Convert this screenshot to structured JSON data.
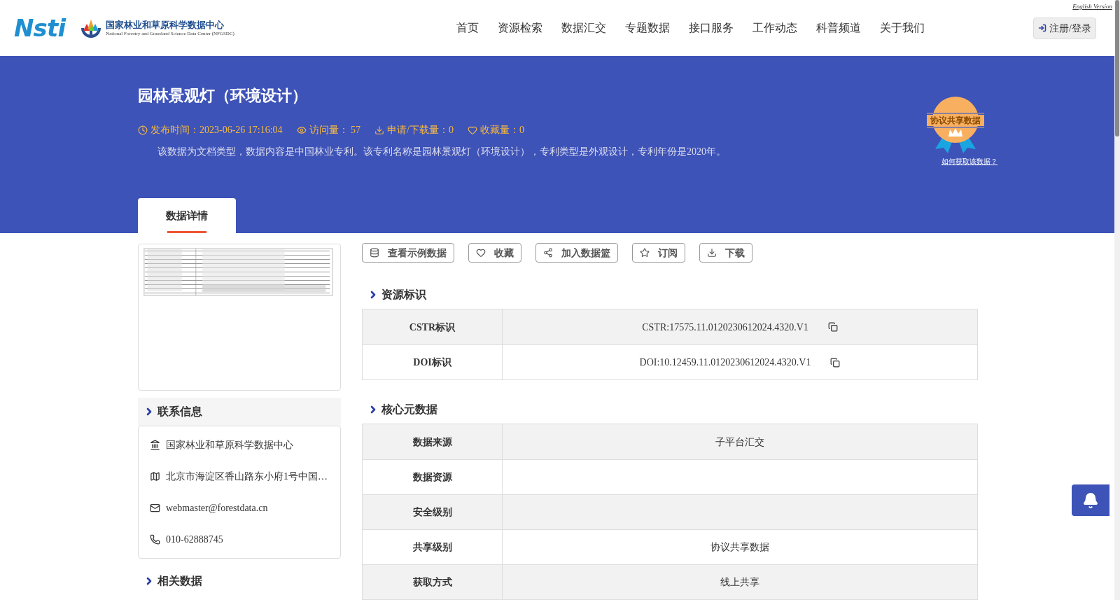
{
  "header": {
    "logo_text": "Nsti",
    "org_name": "国家林业和草原科学数据中心",
    "org_name_en": "National Forestry and Grassland Science Data Center (NFGSDC)",
    "english_link": "English Version",
    "nav": [
      {
        "label": "首页"
      },
      {
        "label": "资源检索"
      },
      {
        "label": "数据汇交"
      },
      {
        "label": "专题数据"
      },
      {
        "label": "接口服务"
      },
      {
        "label": "工作动态"
      },
      {
        "label": "科普频道"
      },
      {
        "label": "关于我们"
      }
    ],
    "login_button": "注册/登录"
  },
  "banner": {
    "title": "园林景观灯（环境设计）",
    "meta": [
      {
        "kind": "time",
        "text": "发布时间：2023-06-26 17:16:04"
      },
      {
        "kind": "views",
        "text": "访问量： 57"
      },
      {
        "kind": "downloads",
        "text": "申请/下载量：0"
      },
      {
        "kind": "favorites",
        "text": "收藏量：0"
      }
    ],
    "description": "该数据为文档类型，数据内容是中国林业专利。该专利名称是园林景观灯（环境设计），专利类型是外观设计，专利年份是2020年。",
    "badge": "协议共享数据",
    "badge_link": "如何获取该数据？"
  },
  "tabs": [
    {
      "label": "数据详情",
      "selected": true
    }
  ],
  "contact": {
    "title": "联系信息",
    "items": [
      {
        "kind": "org",
        "text": "国家林业和草原科学数据中心"
      },
      {
        "kind": "address",
        "text": "北京市海淀区香山路东小府1号中国…"
      },
      {
        "kind": "email",
        "text": "webmaster@forestdata.cn"
      },
      {
        "kind": "phone",
        "text": "010-62888745"
      }
    ]
  },
  "related": {
    "title": "相关数据"
  },
  "actions": [
    {
      "kind": "sample",
      "label": "查看示例数据"
    },
    {
      "kind": "favorite",
      "label": "收藏"
    },
    {
      "kind": "basket",
      "label": "加入数据篮"
    },
    {
      "kind": "subscribe",
      "label": "订阅"
    },
    {
      "kind": "download",
      "label": "下载"
    }
  ],
  "sections": [
    {
      "title": "资源标识",
      "rows": [
        {
          "label": "CSTR标识",
          "value": "CSTR:17575.11.0120230612024.4320.V1",
          "copyable": true
        },
        {
          "label": "DOI标识",
          "value": "DOI:10.12459.11.0120230612024.4320.V1",
          "copyable": true
        }
      ]
    },
    {
      "title": "核心元数据",
      "rows": [
        {
          "label": "数据来源",
          "value": "子平台汇交",
          "copyable": false
        },
        {
          "label": "数据资源",
          "value": "",
          "copyable": false
        },
        {
          "label": "安全级别",
          "value": "",
          "copyable": false
        },
        {
          "label": "共享级别",
          "value": "协议共享数据",
          "copyable": false
        },
        {
          "label": "获取方式",
          "value": "线上共享",
          "copyable": false
        }
      ]
    }
  ]
}
